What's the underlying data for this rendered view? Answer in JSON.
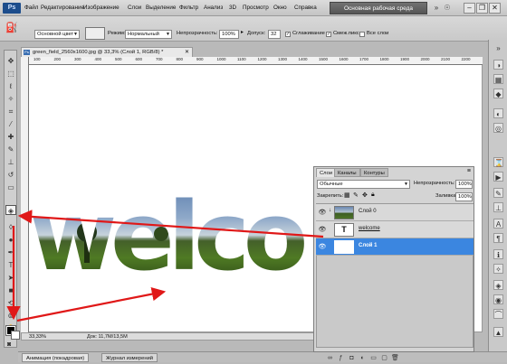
{
  "menubar": {
    "logo": "Ps",
    "items": [
      "Файл",
      "Редактирование",
      "Изображение",
      "Слои",
      "Выделение",
      "Фильтр",
      "Анализ",
      "3D",
      "Просмотр",
      "Окно",
      "Справка"
    ],
    "zoom": "33,3",
    "workspace": "Основная рабочая среда"
  },
  "options": {
    "source": "Основной цвет",
    "mode_label": "Режим:",
    "mode_value": "Нормальный",
    "opacity_label": "Непрозрачность:",
    "opacity_value": "100%",
    "tolerance_label": "Допуск:",
    "tolerance_value": "32",
    "antialias": "Сглаживание",
    "contiguous": "Смеж.пикс",
    "all_layers": "Все слои"
  },
  "document": {
    "tab_title": "green_field_2560x1600.jpg @ 33,3% (Слой 1, RGB/8) *",
    "ruler_ticks": [
      "100",
      "200",
      "300",
      "400",
      "500",
      "600",
      "700",
      "800",
      "900",
      "1000",
      "1100",
      "1200",
      "1300",
      "1400",
      "1500",
      "1600",
      "1700",
      "1800",
      "1900",
      "2000",
      "2100",
      "2200"
    ],
    "canvas_text": "welco",
    "zoom_status": "33,33%",
    "doc_status": "Док: 11,7M/13,5M"
  },
  "layers_panel": {
    "tabs": [
      "Слои",
      "Каналы",
      "Контуры"
    ],
    "blend_mode": "Обычные",
    "opacity_label": "Непрозрачность:",
    "opacity_value": "100%",
    "lock_label": "Закрепить:",
    "fill_label": "Заливка:",
    "fill_value": "100%",
    "layers": [
      {
        "name": "Слой 0"
      },
      {
        "name": "welcome",
        "thumb": "T"
      },
      {
        "name": "Слой 1"
      }
    ]
  },
  "bottom_tabs": [
    "Анимация (покадровая)",
    "Журнал измерений"
  ],
  "colors": {
    "accent": "#3b86e0",
    "arrow": "#e01818",
    "foreground": "#000000",
    "background": "#ffffff"
  }
}
